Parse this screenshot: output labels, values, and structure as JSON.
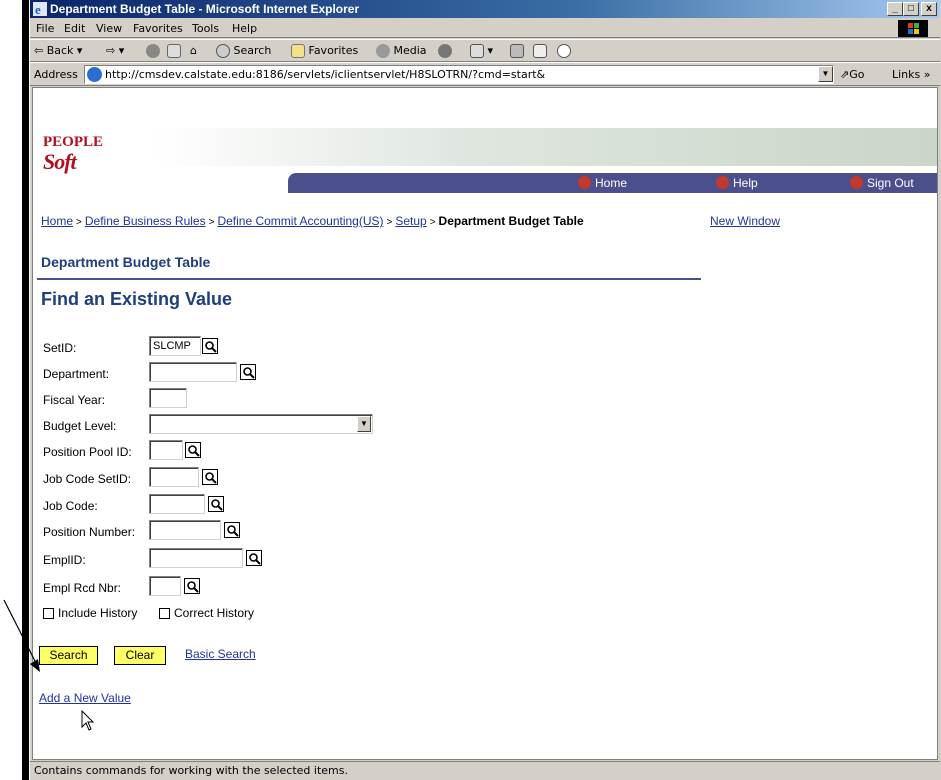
{
  "window": {
    "title": "Department Budget Table - Microsoft Internet Explorer",
    "controls": [
      "_",
      "□",
      "x"
    ]
  },
  "menu": {
    "items": [
      "File",
      "Edit",
      "View",
      "Favorites",
      "Tools",
      "Help"
    ]
  },
  "toolbar": {
    "back": "Back",
    "search": "Search",
    "favorites": "Favorites",
    "media": "Media"
  },
  "address": {
    "label": "Address",
    "url": "http://cmsdev.calstate.edu:8186/servlets/iclientservlet/H8SLOTRN/?cmd=start&",
    "go": "Go",
    "links": "Links"
  },
  "banner": {
    "logo_top": "PEOPLE",
    "logo_bottom": "Soft",
    "home": "Home",
    "help": "Help",
    "signout": "Sign Out"
  },
  "breadcrumb": {
    "items": [
      "Home",
      "Define Business Rules",
      "Define Commit Accounting(US)",
      "Setup"
    ],
    "current": "Department Budget Table",
    "separator": ">",
    "new_window": "New Window"
  },
  "page": {
    "header": "Department Budget Table",
    "find_title": "Find an Existing Value"
  },
  "form": {
    "setid": {
      "label": "SetID:",
      "value": "SLCMP"
    },
    "department": {
      "label": "Department:",
      "value": ""
    },
    "fiscal_year": {
      "label": "Fiscal Year:",
      "value": ""
    },
    "budget_level": {
      "label": "Budget Level:",
      "value": ""
    },
    "position_pool_id": {
      "label": "Position Pool ID:",
      "value": ""
    },
    "job_code_setid": {
      "label": "Job Code SetID:",
      "value": ""
    },
    "job_code": {
      "label": "Job Code:",
      "value": ""
    },
    "position_number": {
      "label": "Position Number:",
      "value": ""
    },
    "emplid": {
      "label": "EmplID:",
      "value": ""
    },
    "empl_rcd_nbr": {
      "label": "Empl Rcd Nbr:",
      "value": ""
    },
    "include_history": {
      "label": "Include History",
      "checked": false
    },
    "correct_history": {
      "label": "Correct History",
      "checked": false
    }
  },
  "actions": {
    "search": "Search",
    "clear": "Clear",
    "basic_search": "Basic Search",
    "add_new_value": "Add a New Value"
  },
  "status": {
    "text": "Contains commands for working with the selected items."
  },
  "colors": {
    "link": "#2033a0",
    "header": "#1f3f7a",
    "nav_bar": "#4b4f8c",
    "button": "#ffff66"
  }
}
